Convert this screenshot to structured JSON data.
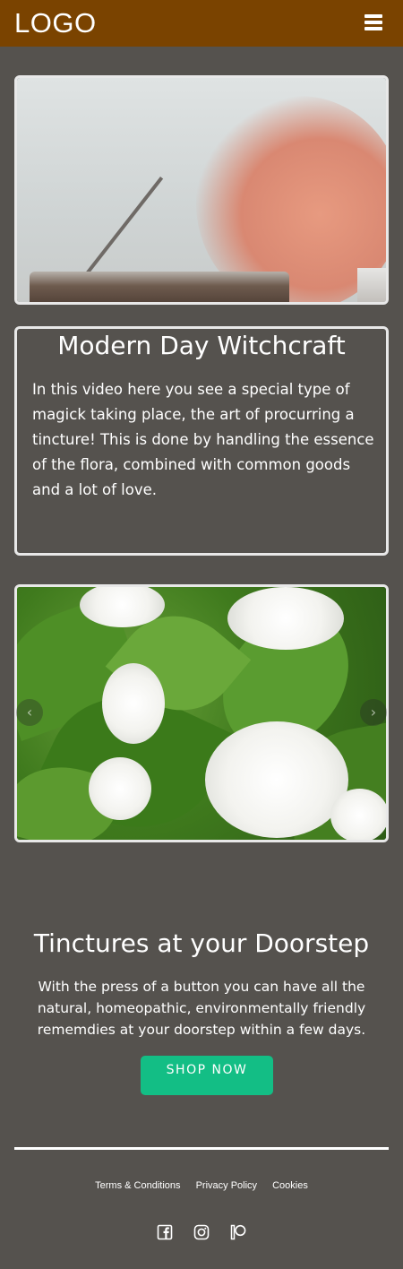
{
  "header": {
    "logo_text": "LOGO",
    "menu_icon": "hamburger-icon",
    "background": "#7a4300"
  },
  "video": {
    "thumbnail_desc_icon": "video-player"
  },
  "info_card": {
    "title": "Modern Day Witchcraft",
    "body": "In this video here you see a special type of magick taking place, the art of procurring a tincture! This is done by handling the essence of the flora, combined with common goods and a lot of love."
  },
  "carousel": {
    "prev_icon": "chevron-left-icon",
    "next_icon": "chevron-right-icon",
    "next_label": "›",
    "prev_label": "‹"
  },
  "promo": {
    "title": "Tinctures at your Doorstep",
    "text": "With the press of a button you can have all the natural, homeopathic, environmentally friendly rememdies at your doorstep within a few days.",
    "button_label": "SHOP NOW",
    "button_color": "#13be85"
  },
  "footer": {
    "links": [
      "Terms & Conditions",
      "Privacy Policy",
      "Cookies"
    ],
    "social_icons": [
      "facebook-icon",
      "instagram-icon",
      "patreon-icon"
    ]
  }
}
